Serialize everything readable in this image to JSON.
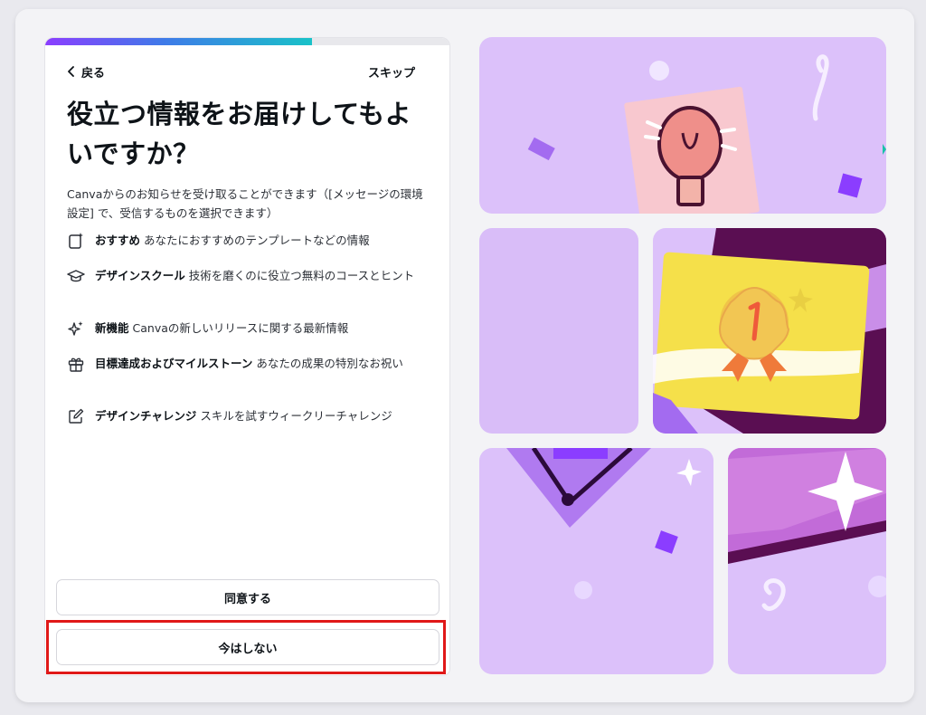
{
  "progress": {
    "fraction": 0.66
  },
  "nav": {
    "back_label": "戻る",
    "skip_label": "スキップ"
  },
  "title": "役立つ情報をお届けしてもよいですか？",
  "description": "Canvaからのお知らせを受け取ることができます（[メッセージの環境設定] で、受信するものを選択できます）",
  "features": [
    {
      "icon": "sparkle-page-icon",
      "title": "おすすめ",
      "text": "あなたにおすすめのテンプレートなどの情報"
    },
    {
      "icon": "graduation-cap-icon",
      "title": "デザインスクール",
      "text": "技術を磨くのに役立つ無料のコースとヒント"
    },
    {
      "icon": "sparkles-icon",
      "title": "新機能",
      "text": "Canvaの新しいリリースに関する最新情報"
    },
    {
      "icon": "gift-icon",
      "title": "目標達成およびマイルストーン",
      "text": "あなたの成果の特別なお祝い"
    },
    {
      "icon": "pencil-edit-icon",
      "title": "デザインチャレンジ",
      "text": "スキルを試すウィークリーチャレンジ"
    }
  ],
  "buttons": {
    "agree_label": "同意する",
    "not_now_label": "今はしない"
  },
  "colors": {
    "accent_purple": "#8b3dff",
    "accent_teal": "#19c2c8",
    "highlight_red": "#e01818",
    "tile_lavender": "#dcc1fa"
  }
}
